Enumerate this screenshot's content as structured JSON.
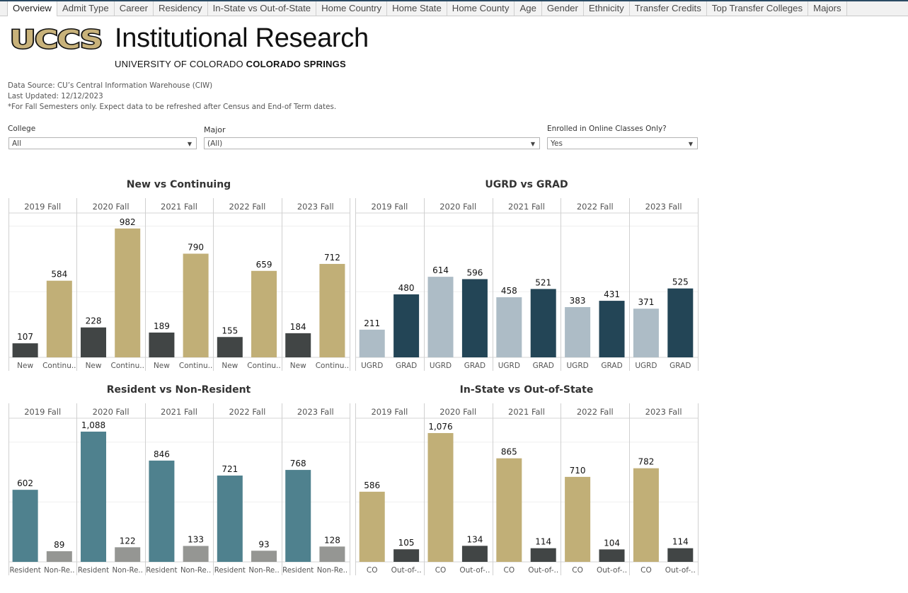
{
  "tabs": [
    {
      "label": "Overview",
      "active": true
    },
    {
      "label": "Admit Type"
    },
    {
      "label": "Career"
    },
    {
      "label": "Residency"
    },
    {
      "label": "In-State vs Out-of-State"
    },
    {
      "label": "Home Country"
    },
    {
      "label": "Home State"
    },
    {
      "label": "Home County"
    },
    {
      "label": "Age"
    },
    {
      "label": "Gender"
    },
    {
      "label": "Ethnicity"
    },
    {
      "label": "Transfer Credits"
    },
    {
      "label": "Top Transfer Colleges"
    },
    {
      "label": "Majors"
    }
  ],
  "header": {
    "logo_text": "UCCS",
    "title": "Institutional Research",
    "subtitle_regular": "UNIVERSITY OF COLORADO ",
    "subtitle_bold": "COLORADO SPRINGS",
    "logo_colors": {
      "gold": "#c8b27a",
      "black": "#111111"
    }
  },
  "info": {
    "data_source": "Data Source: CU’s Central Information Warehouse (CIW)",
    "last_updated": "Last Updated: 12/12/2023",
    "note": "*For Fall Semesters only. Expect data to be refreshed after Census and End-of Term dates."
  },
  "filters": {
    "college": {
      "label": "College",
      "value": "All"
    },
    "major": {
      "label": "Major",
      "value": "(All)"
    },
    "online": {
      "label": "Enrolled in Online Classes Only?",
      "value": "Yes"
    }
  },
  "colors": {
    "gold": "#c1af77",
    "dark_gray": "#414545",
    "light_blue_gray": "#adbcc6",
    "dark_teal_navy": "#234556",
    "teal": "#4f818e",
    "medium_gray": "#959693"
  },
  "chart_data": [
    {
      "type": "bar",
      "id": "new-vs-continuing",
      "title": "New vs Continuing",
      "panels": [
        "2019 Fall",
        "2020 Fall",
        "2021 Fall",
        "2022 Fall",
        "2023 Fall"
      ],
      "categories": [
        "New",
        "Continu.."
      ],
      "series": [
        {
          "name": "New",
          "color": "#414545",
          "values": [
            107,
            228,
            189,
            155,
            184
          ],
          "labels": [
            "107",
            "228",
            "189",
            "155",
            "184"
          ]
        },
        {
          "name": "Continuing",
          "color": "#c1af77",
          "values": [
            584,
            982,
            790,
            659,
            712
          ],
          "labels": [
            "584",
            "982",
            "790",
            "659",
            "712"
          ]
        }
      ],
      "ylim": [
        0,
        1100
      ],
      "gridlines": [
        500,
        1000
      ],
      "grid": true
    },
    {
      "type": "bar",
      "id": "ugrd-vs-grad",
      "title": "UGRD vs GRAD",
      "panels": [
        "2019 Fall",
        "2020 Fall",
        "2021 Fall",
        "2022 Fall",
        "2023 Fall"
      ],
      "categories": [
        "UGRD",
        "GRAD"
      ],
      "series": [
        {
          "name": "UGRD",
          "color": "#adbcc6",
          "values": [
            211,
            614,
            458,
            383,
            371
          ],
          "labels": [
            "211",
            "614",
            "458",
            "383",
            "371"
          ]
        },
        {
          "name": "GRAD",
          "color": "#234556",
          "values": [
            480,
            596,
            521,
            431,
            525
          ],
          "labels": [
            "480",
            "596",
            "521",
            "431",
            "525"
          ]
        }
      ],
      "ylim": [
        0,
        1100
      ],
      "gridlines": [
        500,
        1000
      ],
      "grid": true
    },
    {
      "type": "bar",
      "id": "resident-vs-non-resident",
      "title": "Resident vs Non-Resident",
      "panels": [
        "2019 Fall",
        "2020 Fall",
        "2021 Fall",
        "2022 Fall",
        "2023 Fall"
      ],
      "categories": [
        "Resident",
        "Non-Re.."
      ],
      "series": [
        {
          "name": "Resident",
          "color": "#4f818e",
          "values": [
            602,
            1088,
            846,
            721,
            768
          ],
          "labels": [
            "602",
            "1,088",
            "846",
            "721",
            "768"
          ]
        },
        {
          "name": "Non-Resident",
          "color": "#959693",
          "values": [
            89,
            122,
            133,
            93,
            128
          ],
          "labels": [
            "89",
            "122",
            "133",
            "93",
            "128"
          ]
        }
      ],
      "ylim": [
        0,
        1200
      ],
      "gridlines": [
        500,
        1000
      ],
      "grid": true
    },
    {
      "type": "bar",
      "id": "in-state-vs-out-of-state",
      "title": "In-State vs Out-of-State",
      "panels": [
        "2019 Fall",
        "2020 Fall",
        "2021 Fall",
        "2022 Fall",
        "2023 Fall"
      ],
      "categories": [
        "CO",
        "Out-of-.."
      ],
      "series": [
        {
          "name": "CO",
          "color": "#c1af77",
          "values": [
            586,
            1076,
            865,
            710,
            782
          ],
          "labels": [
            "586",
            "1,076",
            "865",
            "710",
            "782"
          ]
        },
        {
          "name": "Out-of-State",
          "color": "#414545",
          "values": [
            105,
            134,
            114,
            104,
            114
          ],
          "labels": [
            "105",
            "134",
            "114",
            "104",
            "114"
          ]
        }
      ],
      "ylim": [
        0,
        1200
      ],
      "gridlines": [
        500,
        1000
      ],
      "grid": true
    }
  ]
}
